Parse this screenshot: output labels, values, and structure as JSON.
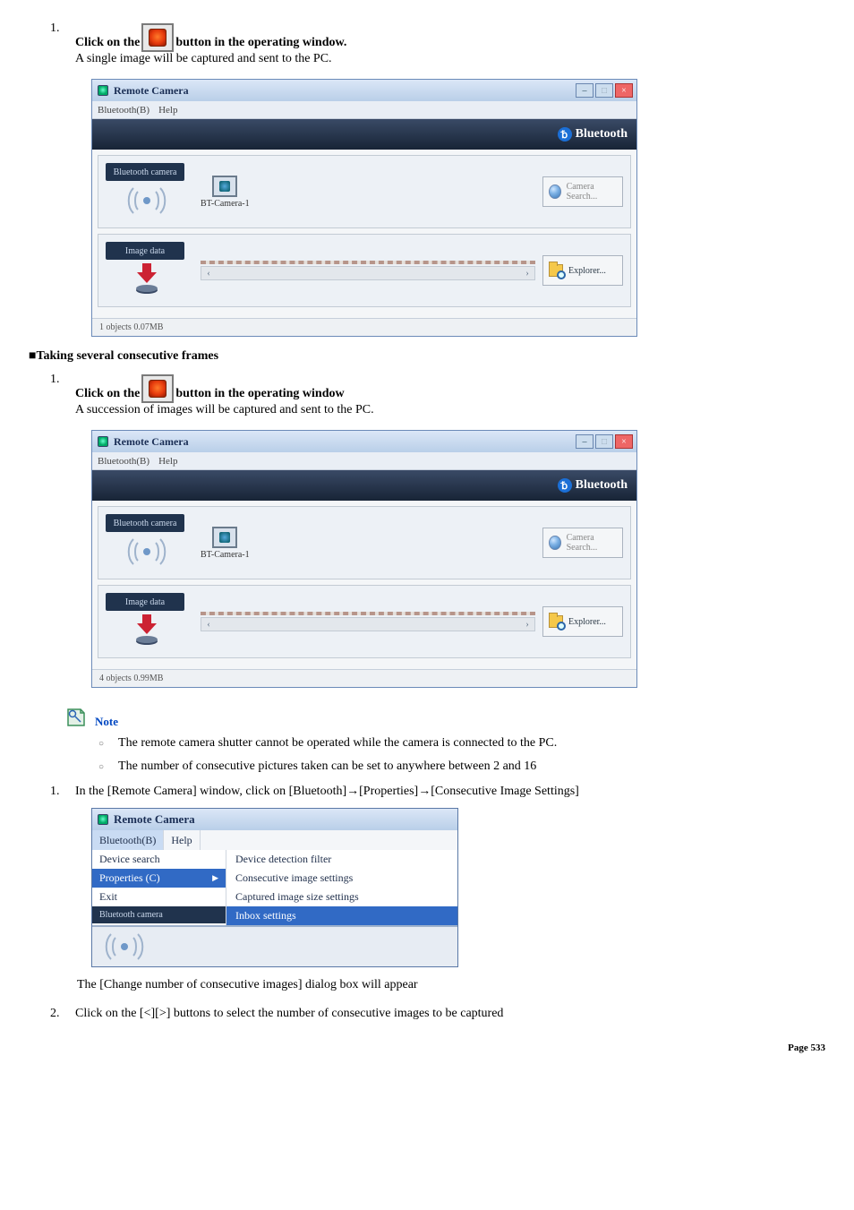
{
  "steps_top": {
    "num": "1.",
    "pre": "Click on the",
    "post": "button in the operating window.",
    "sub": "A single image will be captured and sent to the PC."
  },
  "rc1": {
    "title": "Remote Camera",
    "menu1": "Bluetooth(B)",
    "menu2": "Help",
    "header_brand": "Bluetooth",
    "panel_cam_label": "Bluetooth camera",
    "cam_name": "BT-Camera-1",
    "btn_camera": "Camera Search...",
    "panel_img_label": "Image data",
    "btn_explorer": "Explorer...",
    "status": "1 objects 0.07MB"
  },
  "section2": "■Taking several consecutive frames",
  "steps_mid": {
    "num": "1.",
    "pre": "Click on the",
    "post": "button in the operating window",
    "sub": "A succession of images will be captured and sent to the PC."
  },
  "rc2": {
    "title": "Remote Camera",
    "menu1": "Bluetooth(B)",
    "menu2": "Help",
    "header_brand": "Bluetooth",
    "panel_cam_label": "Bluetooth camera",
    "cam_name": "BT-Camera-1",
    "btn_camera": "Camera Search...",
    "panel_img_label": "Image data",
    "btn_explorer": "Explorer...",
    "status": "4 objects 0.99MB"
  },
  "note": {
    "label": "Note",
    "items": [
      "The remote camera shutter cannot be operated while the camera is connected to the PC.",
      "The number of consecutive pictures taken can be set to anywhere between 2 and 16"
    ]
  },
  "step_settings": {
    "num": "1.",
    "text": "In the [Remote Camera] window, click on [Bluetooth]→[Properties]→[Consecutive Image Settings]"
  },
  "menu_shot": {
    "title": "Remote Camera",
    "bt": "Bluetooth(B)",
    "help": "Help",
    "col1": {
      "dev": "Device search",
      "prop": "Properties (C)",
      "exit": "Exit",
      "ext": "Bluetooth camera"
    },
    "col2": {
      "ddf": "Device detection filter",
      "cis": "Consecutive image settings",
      "ciss": "Captured image size settings",
      "inbox": "Inbox settings"
    }
  },
  "after_menu": "The [Change number of consecutive images] dialog box will appear",
  "step2": {
    "num": "2.",
    "text": "Click on the [<][>] buttons to select the number of consecutive images to be captured"
  },
  "page": {
    "label": "Page",
    "num": "533"
  }
}
